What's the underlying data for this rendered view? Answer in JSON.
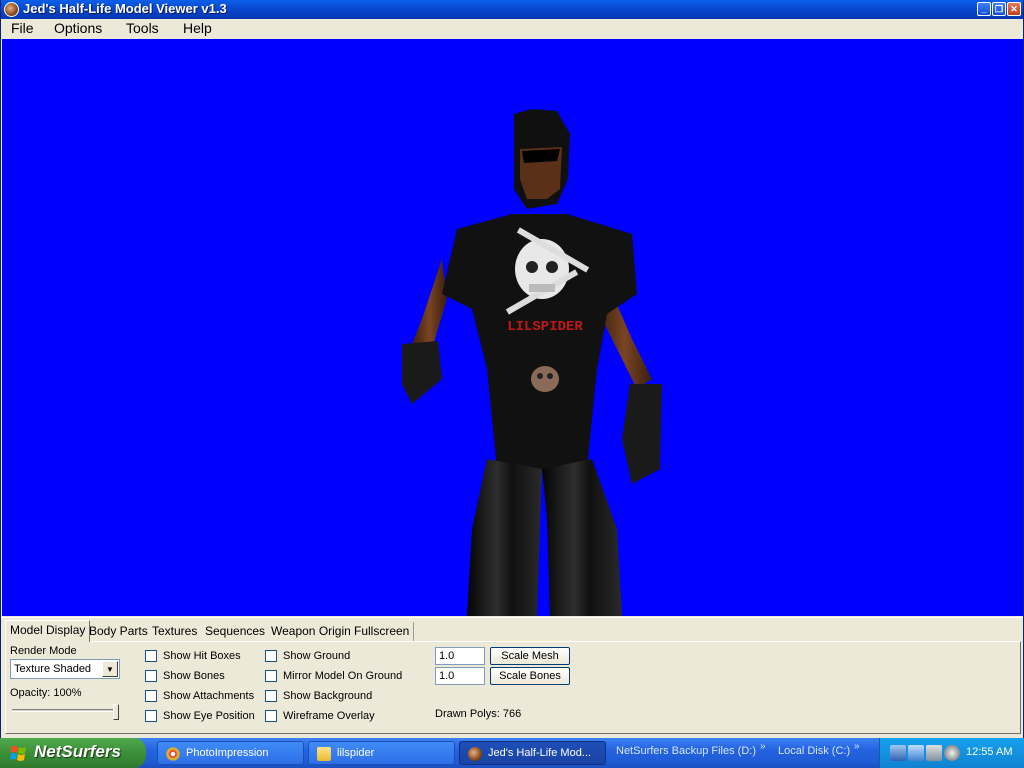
{
  "window": {
    "title": "Jed's Half-Life Model Viewer v1.3"
  },
  "menubar": {
    "items": [
      "File",
      "Options",
      "Tools",
      "Help"
    ]
  },
  "viewport": {
    "background": "#0000ff",
    "shirt_text": "LILSPIDER"
  },
  "tabs": [
    "Model Display",
    "Body Parts",
    "Textures",
    "Sequences",
    "Weapon Origin",
    "Fullscreen"
  ],
  "model_display": {
    "render_mode_label": "Render Mode",
    "render_mode_value": "Texture Shaded",
    "opacity_label": "Opacity: 100%",
    "opacity_value": 1.0,
    "checkboxes_col1": [
      "Show Hit Boxes",
      "Show Bones",
      "Show Attachments",
      "Show Eye Position"
    ],
    "checkboxes_col2": [
      "Show Ground",
      "Mirror Model On Ground",
      "Show Background",
      "Wireframe Overlay"
    ],
    "scale_mesh_value": "1.0",
    "scale_bones_value": "1.0",
    "scale_mesh_button": "Scale Mesh",
    "scale_bones_button": "Scale Bones",
    "drawn_polys": "Drawn Polys: 766"
  },
  "taskbar": {
    "start_label": "NetSurfers",
    "tasks": [
      "PhotoImpression",
      "lilspider",
      "Jed's Half-Life Mod..."
    ],
    "toolbars": [
      "NetSurfers Backup Files (D:)",
      "Local Disk (C:)"
    ],
    "clock": "12:55 AM"
  }
}
